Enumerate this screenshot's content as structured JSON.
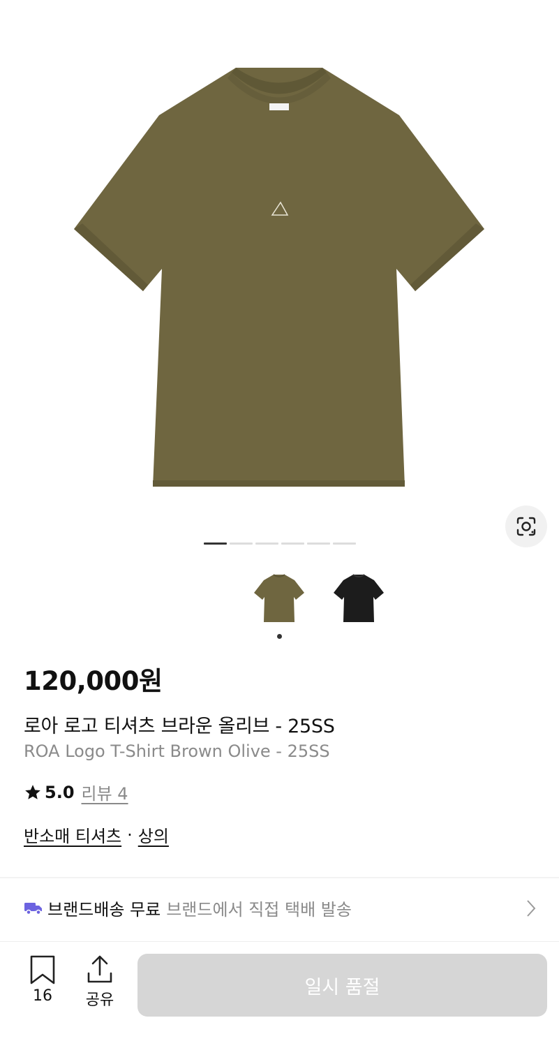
{
  "product": {
    "price": "120,000원",
    "name_ko": "로아 로고 티셔츠 브라운 올리브 - 25SS",
    "name_en": "ROA Logo T-Shirt Brown Olive - 25SS",
    "image_count": 6,
    "active_image_index": 0,
    "colors": {
      "shirt_main": "#6f6640",
      "shirt_black": "#1c1c1c"
    }
  },
  "rating": {
    "score": "5.0",
    "review_label": "리뷰 4"
  },
  "categories": [
    "반소매 티셔츠",
    "상의"
  ],
  "category_separator": "·",
  "shipping": {
    "title": "브랜드배송 무료",
    "description": "브랜드에서 직접 택배 발송",
    "icon": "truck-icon",
    "icon_color": "#6c63e0"
  },
  "bottom_bar": {
    "bookmark_count": "16",
    "share_label": "공유",
    "buy_button_label": "일시 품절",
    "buy_button_color": "#d6d6d6"
  }
}
